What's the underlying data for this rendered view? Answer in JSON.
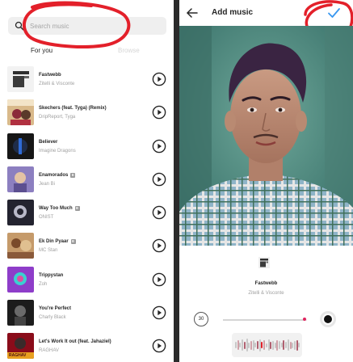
{
  "left": {
    "search": {
      "placeholder": "Search music"
    },
    "tabs": [
      {
        "label": "For you",
        "active": true
      },
      {
        "label": "Browse",
        "active": false
      }
    ],
    "tracks": [
      {
        "title": "Fastwebb",
        "artist": "Zitelli & Visconte",
        "explicit": false,
        "art_colors": [
          "#e8e8e8",
          "#3b3b3b"
        ]
      },
      {
        "title": "Skechers (feat. Tyga) (Remix)",
        "artist": "DripReport, Tyga",
        "explicit": false,
        "art_colors": [
          "#c9a66b",
          "#8b2a3a"
        ]
      },
      {
        "title": "Believer",
        "artist": "Imagine Dragons",
        "explicit": false,
        "art_colors": [
          "#1b1b1b",
          "#2f6bd6"
        ]
      },
      {
        "title": "Enamorados",
        "artist": "Jean Bi",
        "explicit": true,
        "art_colors": [
          "#7e6fb0",
          "#e4c3a4"
        ]
      },
      {
        "title": "Way Too Much",
        "artist": "ONIST",
        "explicit": true,
        "art_colors": [
          "#2a2a3a",
          "#b8b8c8"
        ]
      },
      {
        "title": "Ek Din Pyaar",
        "artist": "MC Stan",
        "explicit": true,
        "art_colors": [
          "#c08a58",
          "#7a4a2a"
        ]
      },
      {
        "title": "Trippystan",
        "artist": "Zoh",
        "explicit": false,
        "art_colors": [
          "#8e3dc9",
          "#3ad0d0"
        ]
      },
      {
        "title": "You're Perfect",
        "artist": "Charly Black",
        "explicit": false,
        "art_colors": [
          "#222222",
          "#7a7a7a"
        ]
      },
      {
        "title": "Let's Work It out (feat. Jahaziel)",
        "artist": "RAGHAV",
        "explicit": false,
        "art_colors": [
          "#a01020",
          "#e8a020"
        ],
        "art_text": "RAGHAV"
      }
    ]
  },
  "right": {
    "title": "Add music",
    "selected": {
      "title": "Fastwebb",
      "artist": "Zitelli & Visconte"
    },
    "duration_label": "30",
    "progress": 0.96,
    "accent_color": "#3897f0",
    "annotation_color": "#e3202a"
  },
  "explicit_symbol": "E"
}
